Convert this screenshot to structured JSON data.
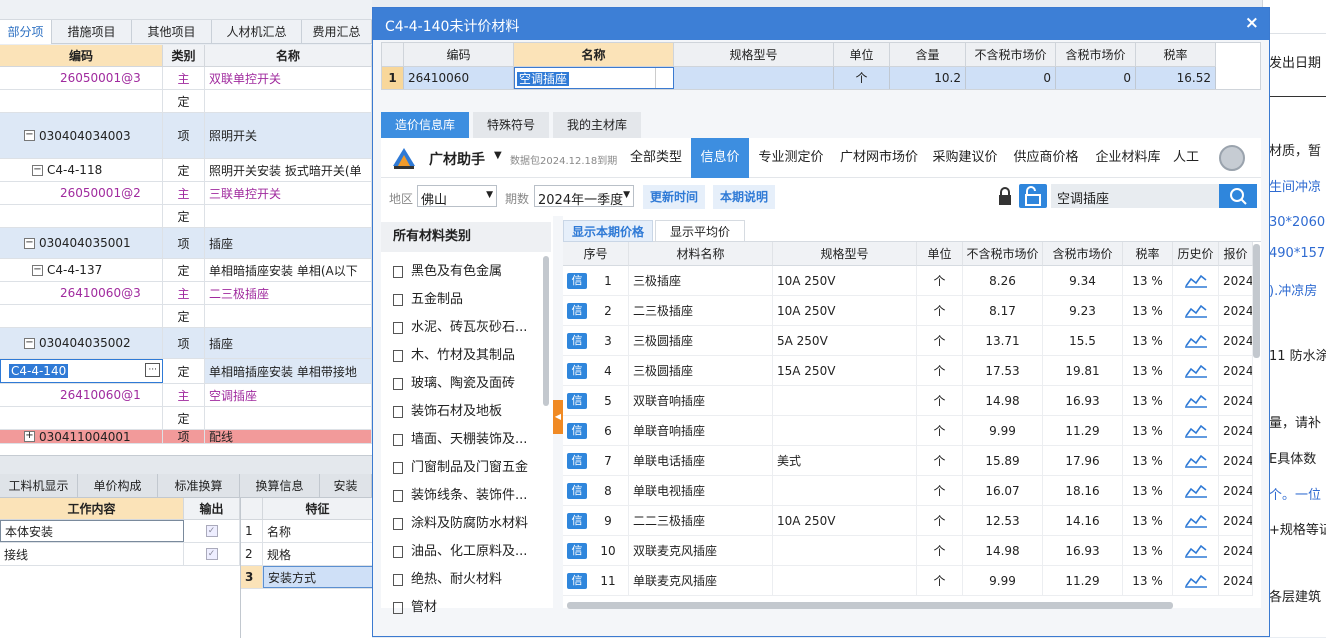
{
  "bg": {
    "tabs": [
      "部分项",
      "措施项目",
      "其他项目",
      "人材机汇总",
      "费用汇总"
    ],
    "grid_headers": [
      "编码",
      "类别",
      "名称"
    ],
    "rows": [
      {
        "code": "26050001@3",
        "type": "主",
        "name": "双联单控开关",
        "kind": "mat"
      },
      {
        "code": "",
        "type": "定",
        "name": "",
        "kind": "blank"
      },
      {
        "code": "030404034003",
        "type": "项",
        "name": "照明开关",
        "kind": "item"
      },
      {
        "code": "C4-4-118",
        "type": "定",
        "name": "照明开关安装 扳式暗开关(单",
        "kind": "quota"
      },
      {
        "code": "26050001@2",
        "type": "主",
        "name": "三联单控开关",
        "kind": "mat"
      },
      {
        "code": "",
        "type": "定",
        "name": "",
        "kind": "blank"
      },
      {
        "code": "030404035001",
        "type": "项",
        "name": "插座",
        "kind": "item"
      },
      {
        "code": "C4-4-137",
        "type": "定",
        "name": "单相暗插座安装 单相(A以下",
        "kind": "quota"
      },
      {
        "code": "26410060@3",
        "type": "主",
        "name": "二三极插座",
        "kind": "mat"
      },
      {
        "code": "",
        "type": "定",
        "name": "",
        "kind": "blank"
      },
      {
        "code": "030404035002",
        "type": "项",
        "name": "插座",
        "kind": "item"
      },
      {
        "code": "C4-4-140",
        "type": "定",
        "name": "单相暗插座安装 单相带接地",
        "kind": "selected"
      },
      {
        "code": "26410060@1",
        "type": "主",
        "name": "空调插座",
        "kind": "mat"
      },
      {
        "code": "",
        "type": "定",
        "name": "",
        "kind": "blank"
      },
      {
        "code": "030411004001",
        "type": "项",
        "name": "配线",
        "kind": "red"
      }
    ],
    "bottom_tabs": [
      "工料机显示",
      "单价构成",
      "标准换算",
      "换算信息",
      "安装"
    ],
    "work_headers": [
      "工作内容",
      "输出"
    ],
    "work_rows": [
      "本体安装",
      "接线"
    ],
    "feature_header": "特征",
    "feature_rows": [
      {
        "no": "1",
        "name": "名称"
      },
      {
        "no": "2",
        "name": "规格"
      },
      {
        "no": "3",
        "name": "安装方式"
      }
    ]
  },
  "right_strip": [
    "发出日期",
    "材质，暂",
    "生间冲凉",
    "30*2060，",
    "490*1570",
    ").冲凉房",
    "11 防水涂",
    "量，请补",
    "E具体数",
    "个。一位",
    "+规格等证",
    "各层建筑"
  ],
  "dialog": {
    "title": "C4-4-140未计价材料",
    "close": "×",
    "mat_headers": [
      "编码",
      "名称",
      "规格型号",
      "单位",
      "含量",
      "不含税市场价",
      "含税市场价",
      "税率"
    ],
    "mat_row": {
      "no": "1",
      "code": "26410060",
      "name": "空调插座",
      "spec": "",
      "unit": "个",
      "qty": "10.2",
      "price_ex": "0",
      "price_inc": "0",
      "rate": "16.52"
    },
    "sub_tabs": [
      "造价信息库",
      "特殊符号",
      "我的主材库"
    ],
    "toolbar": {
      "brand": "广材助手",
      "data_pkg": "数据包2024.12.18到期",
      "nav": [
        "全部类型",
        "信息价",
        "专业测定价",
        "广材网市场价",
        "采购建议价",
        "供应商价格",
        "企业材料库",
        "人工"
      ]
    },
    "filters": {
      "region_label": "地区",
      "region": "佛山",
      "period_label": "期数",
      "period": "2024年一季度",
      "update_btn": "更新时间",
      "note_btn": "本期说明",
      "search_value": "空调插座"
    },
    "category_title": "所有材料类别",
    "categories": [
      "黑色及有色金属",
      "五金制品",
      "水泥、砖瓦灰砂石...",
      "木、竹材及其制品",
      "玻璃、陶瓷及面砖",
      "装饰石材及地板",
      "墙面、天棚装饰及...",
      "门窗制品及门窗五金",
      "装饰线条、装饰件...",
      "涂料及防腐防水材料",
      "油品、化工原料及...",
      "绝热、耐火材料",
      "管材"
    ],
    "price_tabs": [
      "显示本期价格",
      "显示平均价"
    ],
    "price_headers": [
      "序号",
      "材料名称",
      "规格型号",
      "单位",
      "不含税市场价",
      "含税市场价",
      "税率",
      "历史价",
      "报价"
    ],
    "badge": "信",
    "price_rows": [
      {
        "no": "1",
        "name": "三极插座",
        "spec": "10A 250V",
        "unit": "个",
        "ex": "8.26",
        "inc": "9.34",
        "rate": "13 %",
        "date": "2024"
      },
      {
        "no": "2",
        "name": "二三极插座",
        "spec": "10A 250V",
        "unit": "个",
        "ex": "8.17",
        "inc": "9.23",
        "rate": "13 %",
        "date": "2024"
      },
      {
        "no": "3",
        "name": "三极圆插座",
        "spec": "5A 250V",
        "unit": "个",
        "ex": "13.71",
        "inc": "15.5",
        "rate": "13 %",
        "date": "2024"
      },
      {
        "no": "4",
        "name": "三极圆插座",
        "spec": "15A 250V",
        "unit": "个",
        "ex": "17.53",
        "inc": "19.81",
        "rate": "13 %",
        "date": "2024"
      },
      {
        "no": "5",
        "name": "双联音响插座",
        "spec": "",
        "unit": "个",
        "ex": "14.98",
        "inc": "16.93",
        "rate": "13 %",
        "date": "2024"
      },
      {
        "no": "6",
        "name": "单联音响插座",
        "spec": "",
        "unit": "个",
        "ex": "9.99",
        "inc": "11.29",
        "rate": "13 %",
        "date": "2024"
      },
      {
        "no": "7",
        "name": "单联电话插座",
        "spec": "美式",
        "unit": "个",
        "ex": "15.89",
        "inc": "17.96",
        "rate": "13 %",
        "date": "2024"
      },
      {
        "no": "8",
        "name": "单联电视插座",
        "spec": "",
        "unit": "个",
        "ex": "16.07",
        "inc": "18.16",
        "rate": "13 %",
        "date": "2024"
      },
      {
        "no": "9",
        "name": "二二三极插座",
        "spec": "10A 250V",
        "unit": "个",
        "ex": "12.53",
        "inc": "14.16",
        "rate": "13 %",
        "date": "2024"
      },
      {
        "no": "10",
        "name": "双联麦克风插座",
        "spec": "",
        "unit": "个",
        "ex": "14.98",
        "inc": "16.93",
        "rate": "13 %",
        "date": "2024"
      },
      {
        "no": "11",
        "name": "单联麦克风插座",
        "spec": "",
        "unit": "个",
        "ex": "9.99",
        "inc": "11.29",
        "rate": "13 %",
        "date": "2024"
      }
    ]
  }
}
